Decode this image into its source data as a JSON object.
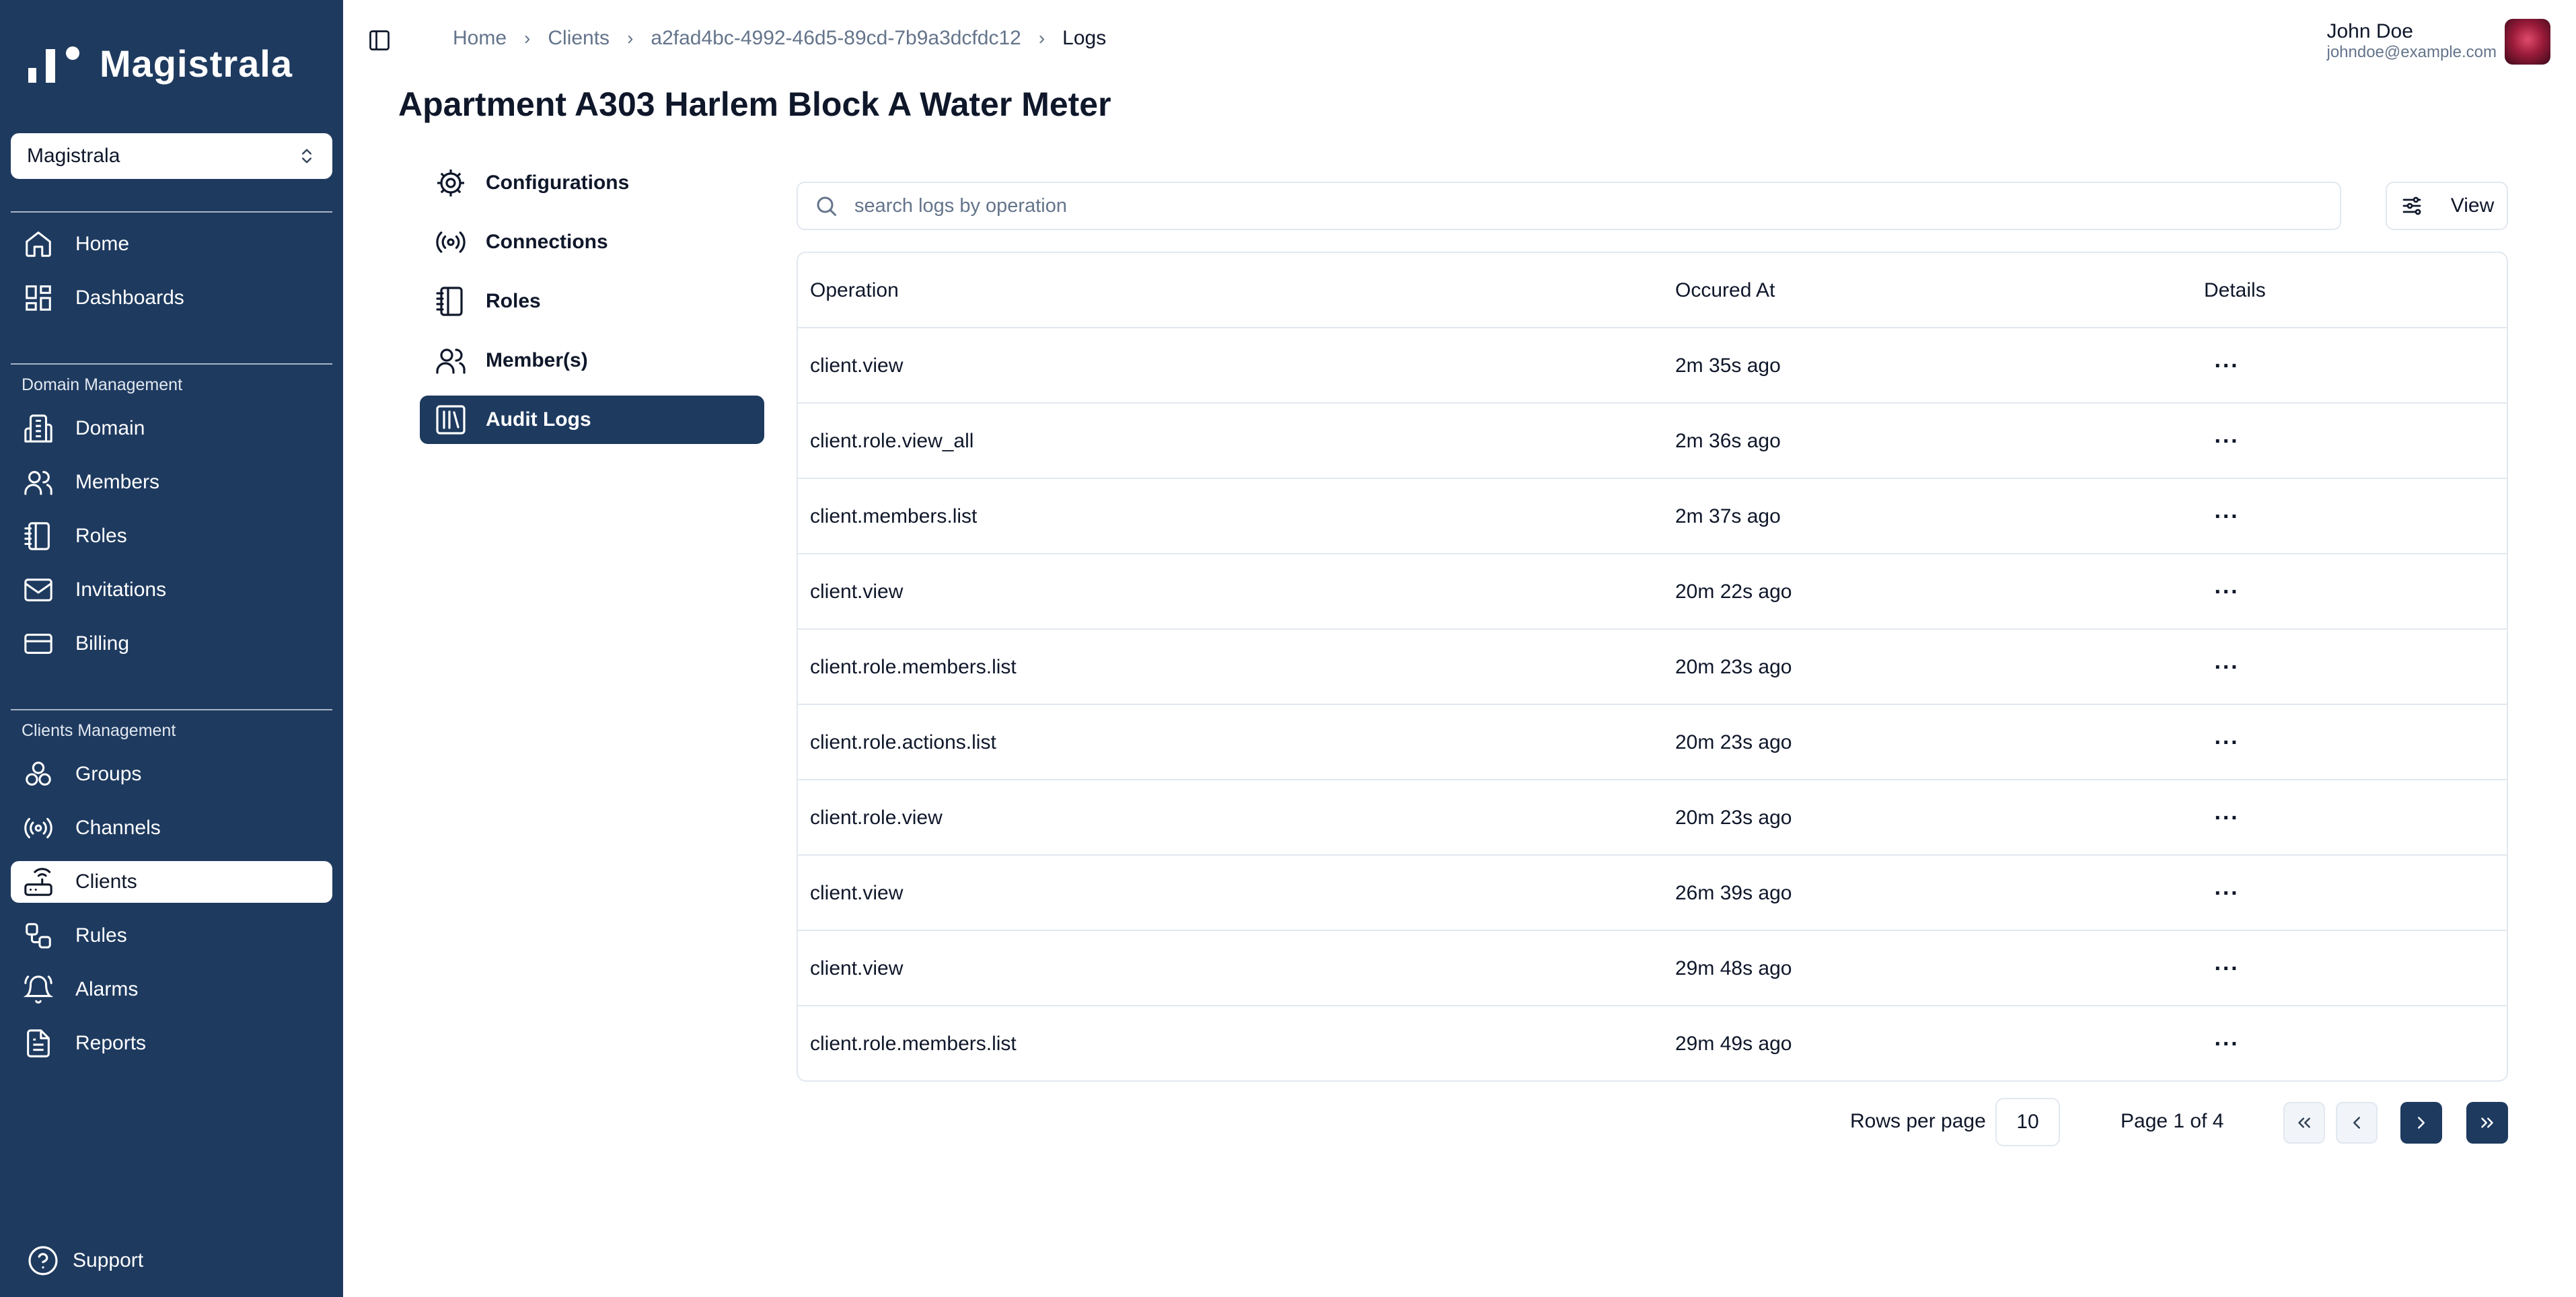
{
  "app": {
    "name": "Magistrala"
  },
  "sidebar": {
    "domain_select": "Magistrala",
    "top_items": [
      {
        "label": "Home",
        "icon": "home-icon"
      },
      {
        "label": "Dashboards",
        "icon": "dashboard-icon"
      }
    ],
    "domain_section": {
      "title": "Domain Management",
      "items": [
        {
          "label": "Domain",
          "icon": "domain-icon"
        },
        {
          "label": "Members",
          "icon": "members-icon"
        },
        {
          "label": "Roles",
          "icon": "roles-icon"
        },
        {
          "label": "Invitations",
          "icon": "mail-icon"
        },
        {
          "label": "Billing",
          "icon": "credit-card-icon"
        }
      ]
    },
    "clients_section": {
      "title": "Clients Management",
      "items": [
        {
          "label": "Groups",
          "icon": "groups-icon"
        },
        {
          "label": "Channels",
          "icon": "radio-icon"
        },
        {
          "label": "Clients",
          "icon": "router-icon",
          "active": true
        },
        {
          "label": "Rules",
          "icon": "workflow-icon"
        },
        {
          "label": "Alarms",
          "icon": "bell-icon"
        },
        {
          "label": "Reports",
          "icon": "file-icon"
        }
      ]
    },
    "support_label": "Support"
  },
  "breadcrumb": [
    "Home",
    "Clients",
    "a2fad4bc-4992-46d5-89cd-7b9a3dcfdc12",
    "Logs"
  ],
  "user": {
    "name": "John Doe",
    "email": "johndoe@example.com"
  },
  "page_title": "Apartment A303 Harlem Block A Water Meter",
  "subnav": [
    {
      "label": "Configurations",
      "icon": "gear-icon"
    },
    {
      "label": "Connections",
      "icon": "radio-icon"
    },
    {
      "label": "Roles",
      "icon": "notebook-icon"
    },
    {
      "label": "Member(s)",
      "icon": "users-icon"
    },
    {
      "label": "Audit Logs",
      "icon": "library-icon",
      "active": true
    }
  ],
  "search": {
    "placeholder": "search logs by operation"
  },
  "view_button": "View",
  "table": {
    "columns": [
      "Operation",
      "Occured At",
      "Details"
    ],
    "rows": [
      {
        "operation": "client.view",
        "occured_at": "2m 35s ago"
      },
      {
        "operation": "client.role.view_all",
        "occured_at": "2m 36s ago"
      },
      {
        "operation": "client.members.list",
        "occured_at": "2m 37s ago"
      },
      {
        "operation": "client.view",
        "occured_at": "20m 22s ago"
      },
      {
        "operation": "client.role.members.list",
        "occured_at": "20m 23s ago"
      },
      {
        "operation": "client.role.actions.list",
        "occured_at": "20m 23s ago"
      },
      {
        "operation": "client.role.view",
        "occured_at": "20m 23s ago"
      },
      {
        "operation": "client.view",
        "occured_at": "26m 39s ago"
      },
      {
        "operation": "client.view",
        "occured_at": "29m 48s ago"
      },
      {
        "operation": "client.role.members.list",
        "occured_at": "29m 49s ago"
      }
    ],
    "details_icon": "more-horizontal-icon"
  },
  "pagination": {
    "rows_per_page_label": "Rows per page",
    "rows_per_page": "10",
    "page_info": "Page 1 of 4"
  },
  "colors": {
    "sidebar": "#1e3a5f",
    "accent": "#1e3a5f",
    "border": "#e2e8f0",
    "muted": "#64748b"
  }
}
